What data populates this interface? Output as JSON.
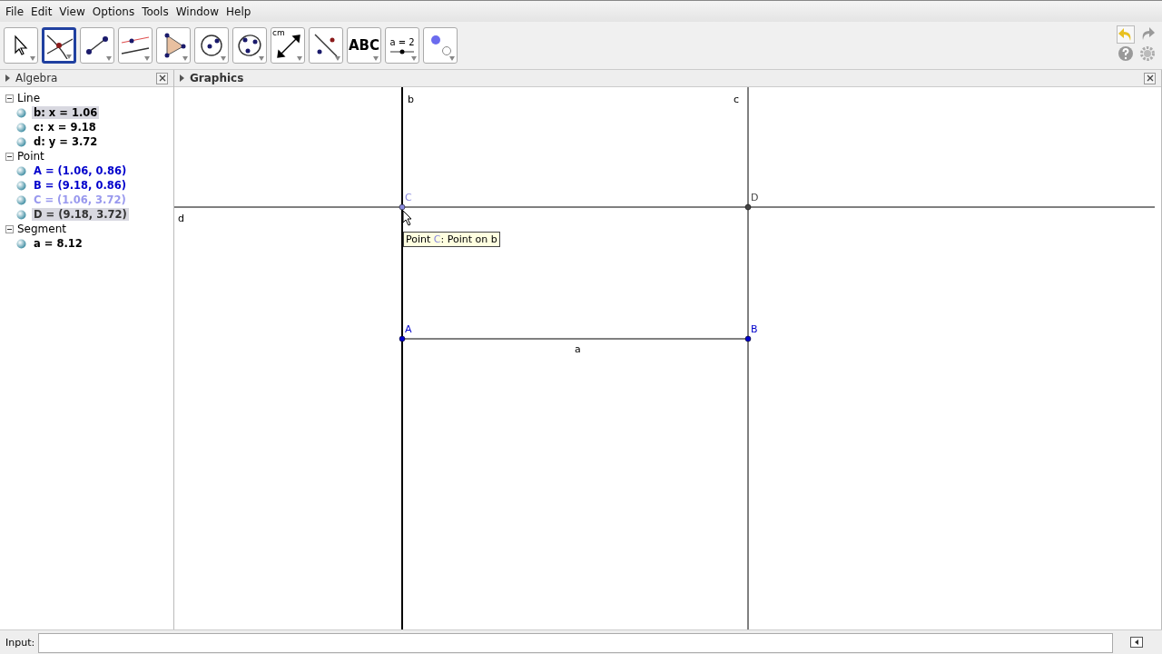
{
  "menu": [
    "File",
    "Edit",
    "View",
    "Options",
    "Tools",
    "Window",
    "Help"
  ],
  "tools": [
    {
      "kind": "move",
      "selected": false
    },
    {
      "kind": "point",
      "selected": true
    },
    {
      "kind": "line",
      "selected": false
    },
    {
      "kind": "parallel",
      "selected": false
    },
    {
      "kind": "polygon",
      "selected": false
    },
    {
      "kind": "circle",
      "selected": false
    },
    {
      "kind": "conic",
      "selected": false
    },
    {
      "kind": "measure",
      "selected": false,
      "text": "cm"
    },
    {
      "kind": "reflect",
      "selected": false
    },
    {
      "kind": "text",
      "selected": false,
      "text": "ABC"
    },
    {
      "kind": "slider",
      "selected": false,
      "text": "a = 2"
    },
    {
      "kind": "style",
      "selected": false
    }
  ],
  "algebra": {
    "title": "Algebra",
    "groups": [
      {
        "name": "Line",
        "items": [
          {
            "text": "b: x = 1.06",
            "color": "#000000",
            "selected": true
          },
          {
            "text": "c: x = 9.18",
            "color": "#000000",
            "selected": false
          },
          {
            "text": "d: y = 3.72",
            "color": "#000000",
            "selected": false
          }
        ]
      },
      {
        "name": "Point",
        "items": [
          {
            "text": "A = (1.06, 0.86)",
            "color": "#0000cc",
            "selected": false
          },
          {
            "text": "B = (9.18, 0.86)",
            "color": "#0000cc",
            "selected": false
          },
          {
            "text": "C = (1.06, 3.72)",
            "color": "#9999ee",
            "selected": false
          },
          {
            "text": "D = (9.18, 3.72)",
            "color": "#333333",
            "selected": true
          }
        ]
      },
      {
        "name": "Segment",
        "items": [
          {
            "text": "a = 8.12",
            "color": "#000000",
            "selected": false
          }
        ]
      }
    ]
  },
  "graphics": {
    "title": "Graphics",
    "lines": [
      {
        "label": "b"
      },
      {
        "label": "c"
      },
      {
        "label": "d"
      }
    ],
    "segment": {
      "label": "a"
    },
    "points": [
      {
        "label": "C",
        "color": "#8888dd"
      },
      {
        "label": "D",
        "color": "#444444"
      },
      {
        "label": "A",
        "color": "#0000cc"
      },
      {
        "label": "B",
        "color": "#0000cc"
      }
    ],
    "tooltip": {
      "prefix": "Point",
      "name": "C",
      "suffix": ": Point on b"
    }
  },
  "input": {
    "label": "Input:"
  }
}
